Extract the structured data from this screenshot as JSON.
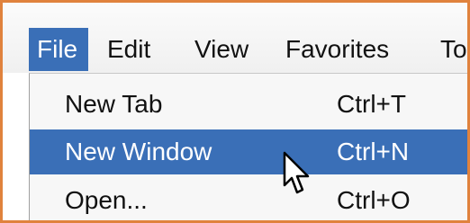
{
  "menubar": {
    "items": [
      {
        "label": "File",
        "active": true
      },
      {
        "label": "Edit"
      },
      {
        "label": "View"
      },
      {
        "label": "Favorites"
      },
      {
        "label": "Too"
      }
    ]
  },
  "file_menu": {
    "items": [
      {
        "label": "New Tab",
        "shortcut": "Ctrl+T"
      },
      {
        "label": "New Window",
        "shortcut": "Ctrl+N",
        "highlighted": true
      },
      {
        "label": "Open...",
        "shortcut": "Ctrl+O"
      }
    ]
  },
  "cursor": {
    "icon": "mouse-pointer-icon"
  },
  "colors": {
    "accent": "#3a6fb7",
    "frame_border": "#e0823d",
    "menu_background": "#f7f7f7"
  }
}
